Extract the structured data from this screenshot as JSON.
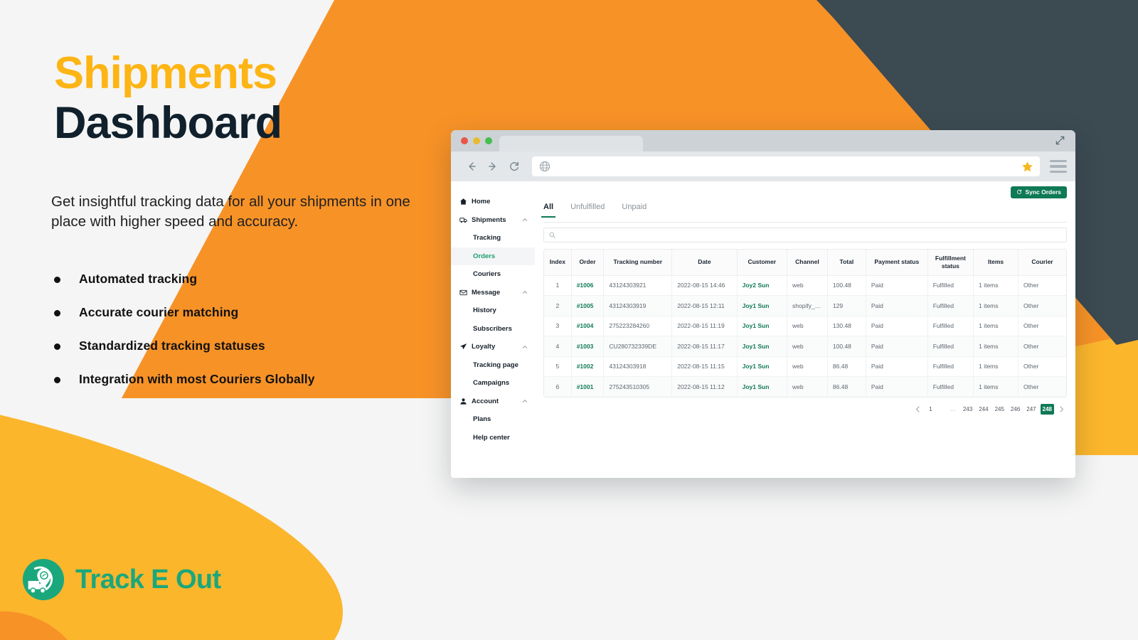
{
  "hero": {
    "title_line1": "Shipments",
    "title_line2": "Dashboard",
    "subtitle": "Get insightful tracking data for all your shipments in one place with higher speed and accuracy.",
    "features": [
      "Automated tracking",
      "Accurate courier matching",
      "Standardized tracking statuses",
      "Integration with most Couriers Globally"
    ]
  },
  "brand": {
    "name": "Track E Out",
    "logo_icon": "truck-location-pin-icon",
    "green": "#1ba77c",
    "yellow": "#fdb515",
    "dark": "#10202c"
  },
  "browser": {
    "back_icon": "arrow-left-icon",
    "forward_icon": "arrow-right-icon",
    "reload_icon": "reload-icon",
    "site_icon": "globe-icon",
    "url": "",
    "bookmark_icon": "star-icon",
    "menu_icon": "hamburger-menu-icon",
    "expand_icon": "expand-arrows-icon",
    "traffic_lights": [
      "close-red",
      "minimize-yellow",
      "maximize-green"
    ]
  },
  "app": {
    "sidebar": [
      {
        "label": "Home",
        "icon": "home-icon",
        "type": "item",
        "caret": false
      },
      {
        "label": "Shipments",
        "icon": "truck-icon",
        "type": "item",
        "caret": true
      },
      {
        "label": "Tracking",
        "type": "sub",
        "active": false
      },
      {
        "label": "Orders",
        "type": "sub",
        "active": true
      },
      {
        "label": "Couriers",
        "type": "sub",
        "active": false
      },
      {
        "label": "Message",
        "icon": "envelope-icon",
        "type": "item",
        "caret": true
      },
      {
        "label": "History",
        "type": "sub",
        "active": false
      },
      {
        "label": "Subscribers",
        "type": "sub",
        "active": false
      },
      {
        "label": "Loyalty",
        "icon": "paper-plane-icon",
        "type": "item",
        "caret": true
      },
      {
        "label": "Tracking page",
        "type": "sub",
        "active": false
      },
      {
        "label": "Campaigns",
        "type": "sub",
        "active": false
      },
      {
        "label": "Account",
        "icon": "user-icon",
        "type": "item",
        "caret": true
      },
      {
        "label": "Plans",
        "type": "sub",
        "active": false
      },
      {
        "label": "Help center",
        "type": "sub",
        "active": false
      }
    ],
    "sync_button": {
      "label": "Sync Orders",
      "icon": "sync-icon",
      "color": "#0f7a55"
    },
    "tabs": [
      {
        "label": "All",
        "active": true
      },
      {
        "label": "Unfulfilled",
        "active": false
      },
      {
        "label": "Unpaid",
        "active": false
      }
    ],
    "search": {
      "value": "",
      "placeholder": "",
      "icon": "search-icon"
    },
    "table": {
      "columns": [
        "Index",
        "Order",
        "Tracking number",
        "Date",
        "Customer",
        "Channel",
        "Total",
        "Payment status",
        "Fulfillment status",
        "Items",
        "Courier"
      ],
      "rows": [
        {
          "index": "1",
          "order": "#1006",
          "tracking": "43124303921",
          "date": "2022-08-15 14:46",
          "customer": "Joy2 Sun",
          "channel": "web",
          "total": "100.48",
          "payment": "Paid",
          "fulfillment": "Fulfilled",
          "items": "1 items",
          "courier": "Other"
        },
        {
          "index": "2",
          "order": "#1005",
          "tracking": "43124303919",
          "date": "2022-08-15 12:11",
          "customer": "Joy1 Sun",
          "channel": "shopify_draft...",
          "total": "129",
          "payment": "Paid",
          "fulfillment": "Fulfilled",
          "items": "1 items",
          "courier": "Other"
        },
        {
          "index": "3",
          "order": "#1004",
          "tracking": "275223284260",
          "date": "2022-08-15 11:19",
          "customer": "Joy1 Sun",
          "channel": "web",
          "total": "130.48",
          "payment": "Paid",
          "fulfillment": "Fulfilled",
          "items": "1 items",
          "courier": "Other"
        },
        {
          "index": "4",
          "order": "#1003",
          "tracking": "CU280732339DE",
          "date": "2022-08-15 11:17",
          "customer": "Joy1 Sun",
          "channel": "web",
          "total": "100.48",
          "payment": "Paid",
          "fulfillment": "Fulfilled",
          "items": "1 items",
          "courier": "Other"
        },
        {
          "index": "5",
          "order": "#1002",
          "tracking": "43124303918",
          "date": "2022-08-15 11:15",
          "customer": "Joy1 Sun",
          "channel": "web",
          "total": "86.48",
          "payment": "Paid",
          "fulfillment": "Fulfilled",
          "items": "1 items",
          "courier": "Other"
        },
        {
          "index": "6",
          "order": "#1001",
          "tracking": "275243510305",
          "date": "2022-08-15 11:12",
          "customer": "Joy1 Sun",
          "channel": "web",
          "total": "86.48",
          "payment": "Paid",
          "fulfillment": "Fulfilled",
          "items": "1 items",
          "courier": "Other"
        }
      ]
    },
    "pagination": {
      "prev_icon": "chevron-left-icon",
      "next_icon": "chevron-right-icon",
      "pages": [
        "1",
        "…",
        "243",
        "244",
        "245",
        "246",
        "247",
        "248"
      ],
      "current": "248"
    }
  }
}
